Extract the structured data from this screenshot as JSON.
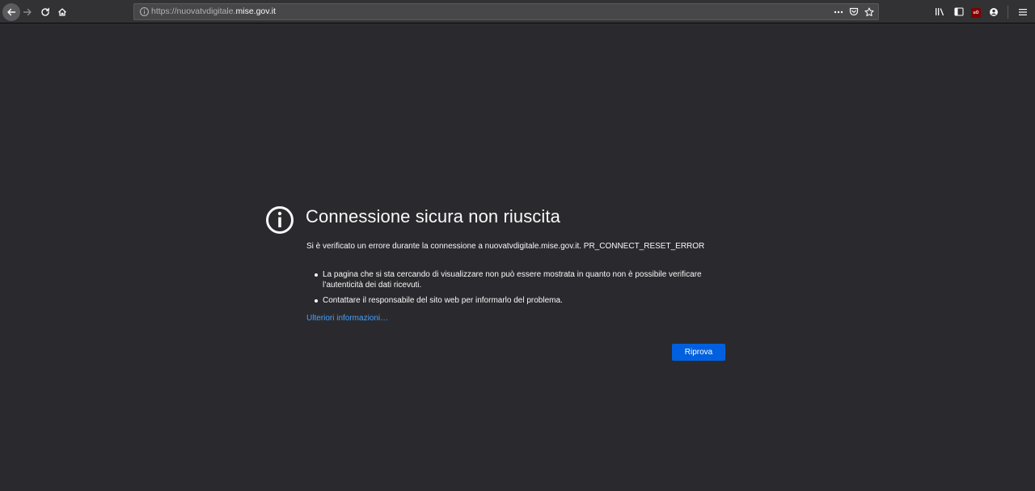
{
  "browser": {
    "url_scheme": "https://nuovatvdigitale.",
    "url_host": "mise.gov.it",
    "icons": [
      "back-icon",
      "forward-icon",
      "reload-icon",
      "home-icon",
      "info-icon",
      "page-actions-icon",
      "pocket-icon",
      "bookmark-star-icon",
      "library-icon",
      "sidebar-icon",
      "ublock-icon",
      "account-icon",
      "menu-icon"
    ],
    "ublock_label": "uO"
  },
  "error": {
    "title": "Connessione sicura non riuscita",
    "description": "Si è verificato un errore durante la connessione a nuovatvdigitale.mise.gov.it. PR_CONNECT_RESET_ERROR",
    "bullets": [
      "La pagina che si sta cercando di visualizzare non può essere mostrata in quanto non è possibile verificare l’autenticità dei dati ricevuti.",
      "Contattare il responsabile del sito web per informarlo del problema."
    ],
    "more_info_link": "Ulteriori informazioni…",
    "retry_button": "Riprova"
  },
  "colors": {
    "page_bg": "#2a2a2e",
    "toolbar_bg": "#323234",
    "link": "#45a1ff",
    "primary_button": "#0060df"
  }
}
